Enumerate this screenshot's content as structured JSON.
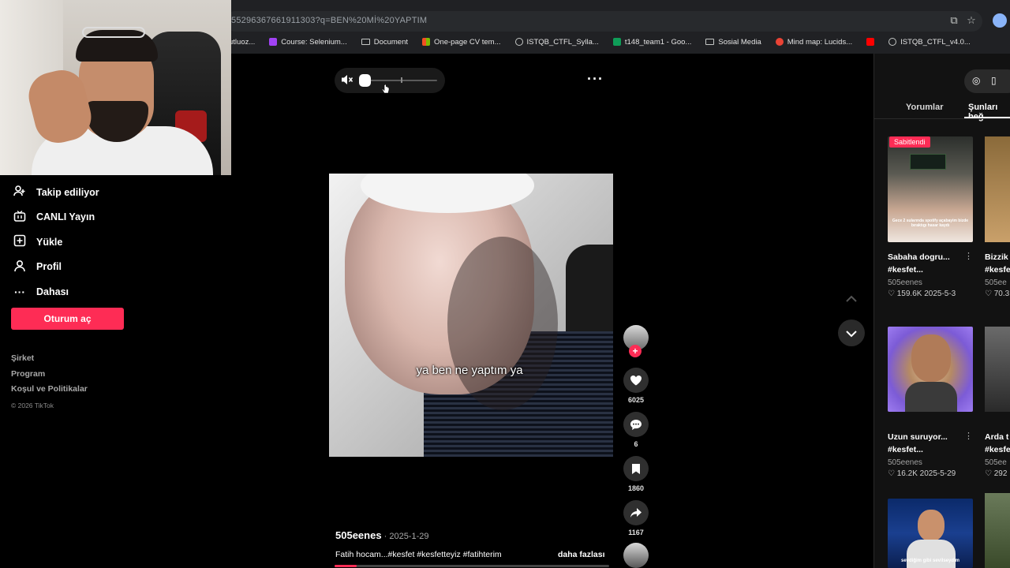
{
  "browser": {
    "url": "5529636766191130​3?q=BEN%20Mİ%20YAPTIM",
    "bookmarks": [
      "utluoz...",
      "Course: Selenium...",
      "Document",
      "One-page CV tem...",
      "ISTQB_CTFL_Sylla...",
      "t148_team1 - Goo...",
      "Sosial Media",
      "Mind map: Lucids...",
      "ISTQB_CTFL_v4.0..."
    ],
    "colors": {
      "bm1": "#a142f4",
      "bm3": "#f25022",
      "bm5": "#0f9d58",
      "bm7": "#ea4335",
      "bm8": "#ff0000"
    }
  },
  "nav": {
    "items": [
      {
        "label": "Takip ediliyor",
        "icon": "following-icon"
      },
      {
        "label": "CANLI Yayın",
        "icon": "live-icon"
      },
      {
        "label": "Yükle",
        "icon": "upload-icon"
      },
      {
        "label": "Profil",
        "icon": "profile-icon"
      },
      {
        "label": "Dahası",
        "icon": "more-icon"
      }
    ],
    "login_label": "Oturum aç",
    "footer": [
      "Şirket",
      "Program",
      "Koşul ve Politikalar"
    ],
    "copyright": "© 2026 TikTok"
  },
  "video": {
    "caption": "ya ben ne yaptım ya",
    "author": "505eenes",
    "date": " · 2025-1-29",
    "description": "Fatih hocam...#kesfet #kesfetteyiz #fatihterim",
    "more_link": "daha fazlası",
    "progress": 0.08
  },
  "actions": {
    "like_count": "6025",
    "comment_count": "6",
    "save_count": "1860",
    "share_count": "1167"
  },
  "panel": {
    "tabs": [
      "Yorumlar",
      "Şunları beğ"
    ],
    "pinned_label": "Sabitlendi",
    "cards": [
      {
        "title1": "Sabaha dogru...",
        "title2": "#kesfet...",
        "author": "505eenes",
        "stats": "♡ 159.6K   2025-5-3",
        "thumb_text": "Gece 2 sularında spotify açabayim bizde bıraktıgı hasar kaydı"
      },
      {
        "title1": "Uzun suruyor...",
        "title2": "#kesfet...",
        "author": "505eenes",
        "stats": "♡ 16.2K   2025-5-29"
      },
      {
        "thumb_text": "sevdiğim gibi sevilseydim"
      }
    ],
    "partial_cards": [
      {
        "title1": "Bizzik",
        "title2": "#kesfe",
        "author": "505ee",
        "stats": "♡ 70.3"
      },
      {
        "title1": "Arda t",
        "title2": "#kesfe",
        "author": "505ee",
        "stats": "♡ 292"
      }
    ]
  }
}
